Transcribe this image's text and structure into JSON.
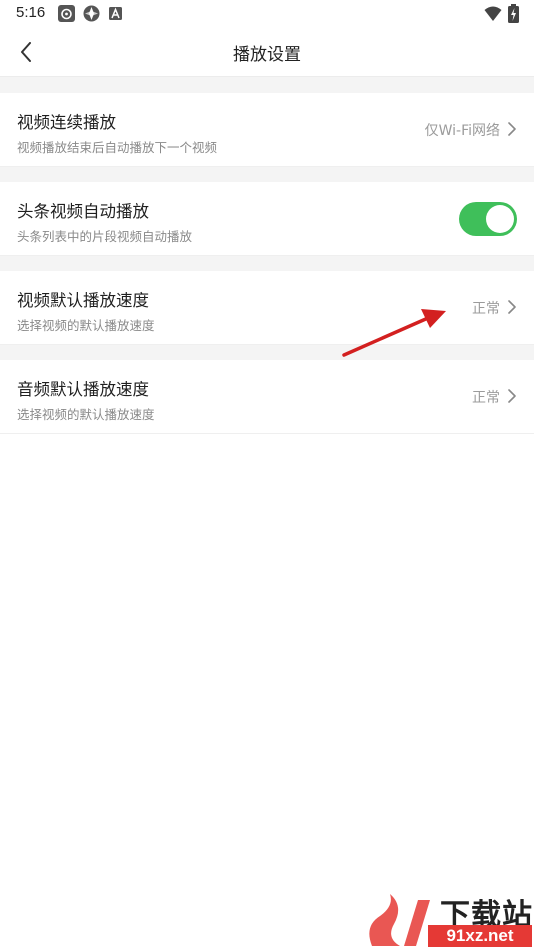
{
  "status_bar": {
    "time": "5:16",
    "icons": [
      "weibo-icon",
      "aperture-icon",
      "a-icon",
      "wifi-icon",
      "battery-charging-icon"
    ]
  },
  "app_bar": {
    "title": "播放设置",
    "back_icon": "chevron-left-icon"
  },
  "settings": [
    {
      "title": "视频连续播放",
      "subtitle": "视频播放结束后自动播放下一个视频",
      "value": "仅Wi-Fi网络",
      "control": "chevron"
    },
    {
      "title": "头条视频自动播放",
      "subtitle": "头条列表中的片段视频自动播放",
      "value": "",
      "control": "toggle",
      "toggle_on": true
    },
    {
      "title": "视频默认播放速度",
      "subtitle": "选择视频的默认播放速度",
      "value": "正常",
      "control": "chevron"
    },
    {
      "title": "音频默认播放速度",
      "subtitle": "选择视频的默认播放速度",
      "value": "正常",
      "control": "chevron"
    }
  ],
  "colors": {
    "toggle_on": "#3fbf5a",
    "annotation_arrow": "#d32020",
    "section_gap": "#f4f4f4"
  },
  "watermark": {
    "brand": "下载站",
    "url": "91xz.net"
  }
}
